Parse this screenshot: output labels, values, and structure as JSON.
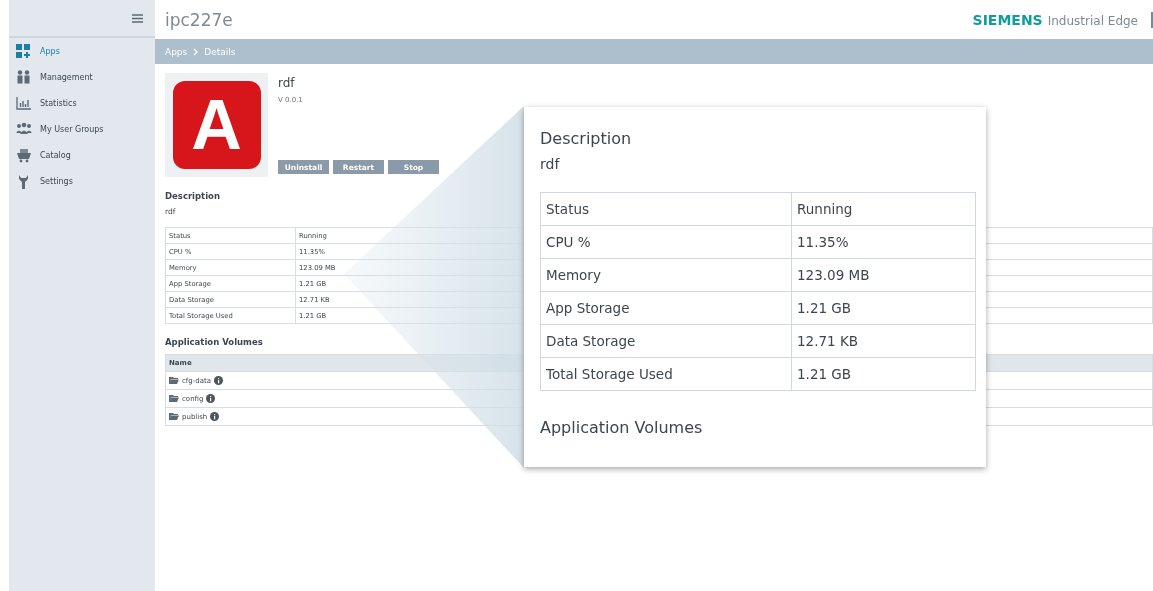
{
  "sidebar": {
    "items": [
      {
        "label": "Apps",
        "selected": true
      },
      {
        "label": "Management",
        "selected": false
      },
      {
        "label": "Statistics",
        "selected": false
      },
      {
        "label": "My User Groups",
        "selected": false
      },
      {
        "label": "Catalog",
        "selected": false
      },
      {
        "label": "Settings",
        "selected": false
      }
    ]
  },
  "header": {
    "title": "ipc227e",
    "brand": "SIEMENS",
    "product": "Industrial Edge"
  },
  "breadcrumb": [
    "Apps",
    "Details"
  ],
  "app": {
    "name": "rdf",
    "version": "V 0.0.1",
    "icon_letter": "A",
    "buttons": [
      "Uninstall",
      "Restart",
      "Stop"
    ]
  },
  "description": {
    "heading": "Description",
    "text": "rdf"
  },
  "properties": [
    {
      "name": "Status",
      "value": "Running"
    },
    {
      "name": "CPU %",
      "value": "11.35%"
    },
    {
      "name": "Memory",
      "value": "123.09 MB"
    },
    {
      "name": "App Storage",
      "value": "1.21 GB"
    },
    {
      "name": "Data Storage",
      "value": "12.71 KB"
    },
    {
      "name": "Total Storage Used",
      "value": "1.21 GB"
    }
  ],
  "volumes": {
    "heading": "Application Volumes",
    "column": "Name",
    "rows": [
      "cfg-data",
      "config",
      "publish"
    ]
  },
  "callout": {
    "description_heading": "Description",
    "description": "rdf",
    "properties": [
      {
        "name": "Status",
        "value": "Running"
      },
      {
        "name": "CPU %",
        "value": "11.35%"
      },
      {
        "name": "Memory",
        "value": "123.09 MB"
      },
      {
        "name": "App Storage",
        "value": "1.21 GB"
      },
      {
        "name": "Data Storage",
        "value": "12.71 KB"
      },
      {
        "name": "Total Storage Used",
        "value": "1.21 GB"
      }
    ],
    "volumes_heading": "Application Volumes"
  }
}
